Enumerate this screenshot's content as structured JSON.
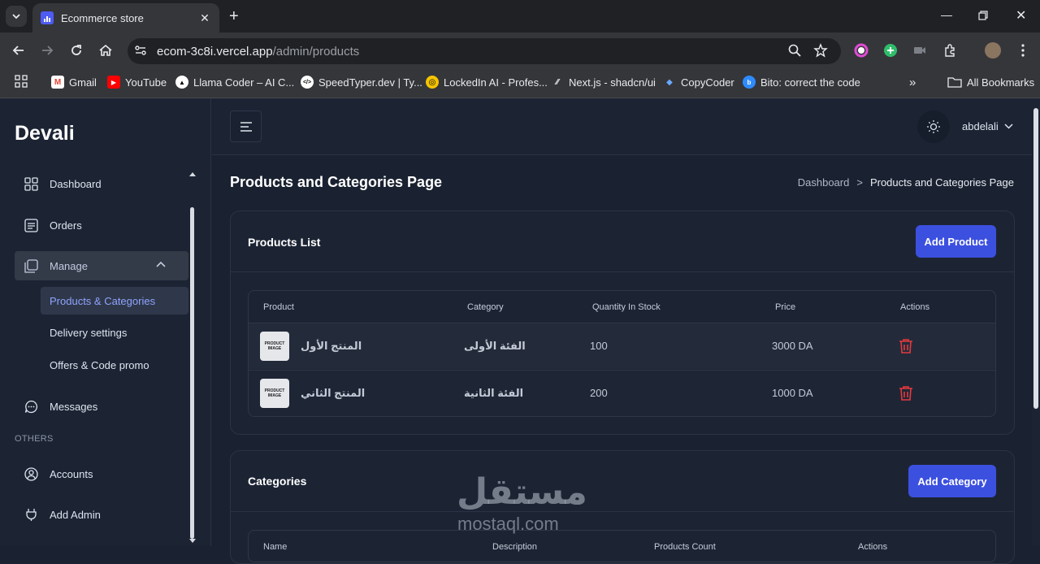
{
  "browser": {
    "tab_title": "Ecommerce store",
    "url_host": "ecom-3c8i.vercel.app",
    "url_path": "/admin/products",
    "bookmarks": [
      {
        "label": "Gmail"
      },
      {
        "label": "YouTube"
      },
      {
        "label": "Llama Coder – AI C..."
      },
      {
        "label": "SpeedTyper.dev | Ty..."
      },
      {
        "label": "LockedIn AI - Profes..."
      },
      {
        "label": "Next.js - shadcn/ui"
      },
      {
        "label": "CopyCoder"
      },
      {
        "label": "Bito: correct the code"
      }
    ],
    "all_bookmarks": "All Bookmarks"
  },
  "sidebar": {
    "brand": "Devali",
    "items": [
      {
        "label": "Dashboard"
      },
      {
        "label": "Orders"
      },
      {
        "label": "Manage"
      },
      {
        "label": "Messages"
      },
      {
        "label": "Accounts"
      },
      {
        "label": "Add Admin"
      }
    ],
    "sub_items": [
      {
        "label": "Products & Categories"
      },
      {
        "label": "Delivery settings"
      },
      {
        "label": "Offers & Code promo"
      }
    ],
    "others_label": "OTHERS"
  },
  "header": {
    "username": "abdelali"
  },
  "page": {
    "title": "Products and Categories Page",
    "breadcrumb": [
      "Dashboard",
      ">",
      "Products and Categories Page"
    ]
  },
  "products": {
    "title": "Products List",
    "add_label": "Add Product",
    "columns": [
      "Product",
      "Category",
      "Quantity In Stock",
      "Price",
      "Actions"
    ],
    "image_placeholder": [
      "PRODUCT",
      "IMAGE"
    ],
    "rows": [
      {
        "name": "المنتج الأول",
        "category": "الفئة الأولى",
        "qty": "100",
        "price": "3000 DA"
      },
      {
        "name": "المنتج الثاني",
        "category": "الفئة الثانية",
        "qty": "200",
        "price": "1000 DA"
      }
    ]
  },
  "categories": {
    "title": "Categories",
    "add_label": "Add Category",
    "columns": [
      "Name",
      "Description",
      "Products Count",
      "Actions"
    ]
  },
  "watermark": {
    "arabic": "مستقل",
    "latin": "mostaql.com"
  },
  "colors": {
    "accent": "#3c50e0",
    "danger": "#e5393d",
    "sidebar_active_text": "#8fa3ff"
  }
}
